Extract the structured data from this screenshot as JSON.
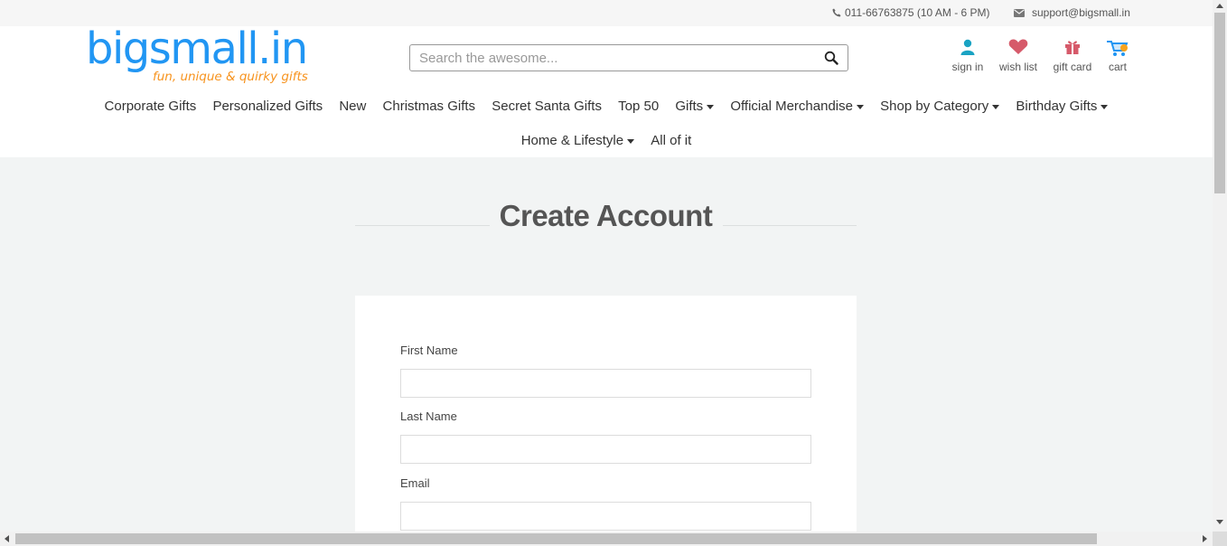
{
  "topbar": {
    "phone_text": "011-66763875 (10 AM - 6 PM)",
    "email_text": "support@bigsmall.in"
  },
  "logo": {
    "text": "bigsmall.in",
    "tagline": "fun, unique & quirky gifts",
    "colors": {
      "text": "#2196f3",
      "tagline": "#f7931e"
    }
  },
  "search": {
    "placeholder": "Search the awesome..."
  },
  "user_icons": [
    {
      "label": "sign in",
      "icon": "user-icon",
      "color": "#1aa3c3"
    },
    {
      "label": "wish list",
      "icon": "heart-icon",
      "color": "#d65a6a"
    },
    {
      "label": "gift card",
      "icon": "gift-icon",
      "color": "#d65a6a"
    },
    {
      "label": "cart",
      "icon": "cart-icon",
      "color": "#2196f3"
    }
  ],
  "nav": {
    "row1": [
      {
        "label": "Corporate Gifts",
        "dropdown": false
      },
      {
        "label": "Personalized Gifts",
        "dropdown": false
      },
      {
        "label": "New",
        "dropdown": false
      },
      {
        "label": "Christmas Gifts",
        "dropdown": false
      },
      {
        "label": "Secret Santa Gifts",
        "dropdown": false
      },
      {
        "label": "Top 50",
        "dropdown": false
      },
      {
        "label": "Gifts",
        "dropdown": true
      },
      {
        "label": "Official Merchandise",
        "dropdown": true
      },
      {
        "label": "Shop by Category",
        "dropdown": true
      },
      {
        "label": "Birthday Gifts",
        "dropdown": true
      }
    ],
    "row2": [
      {
        "label": "Home & Lifestyle",
        "dropdown": true
      },
      {
        "label": "All of it",
        "dropdown": false
      }
    ]
  },
  "main": {
    "title": "Create Account",
    "form": {
      "first_name_label": "First Name",
      "first_name_value": "",
      "last_name_label": "Last Name",
      "last_name_value": "",
      "email_label": "Email",
      "email_value": ""
    }
  }
}
